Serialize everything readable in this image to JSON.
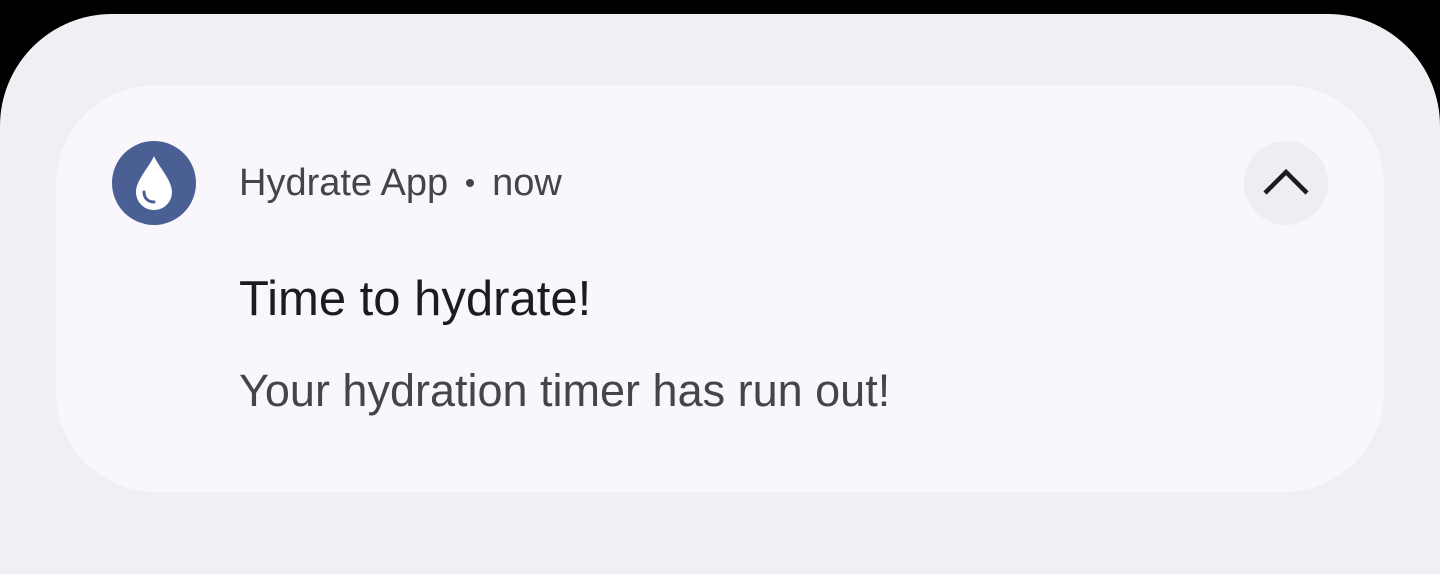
{
  "notification": {
    "app_name": "Hydrate App",
    "separator": "•",
    "time": "now",
    "title": "Time to hydrate!",
    "body": "Your hydration timer has run out!",
    "app_icon": "water-drop-icon",
    "expand_icon": "chevron-up-icon"
  },
  "colors": {
    "background_outer": "#000000",
    "shade": "#f1eff4",
    "card": "#f9f7fc",
    "icon_bg": "#4a5f94",
    "title_text": "#1d1b20",
    "secondary_text": "#45444c"
  }
}
